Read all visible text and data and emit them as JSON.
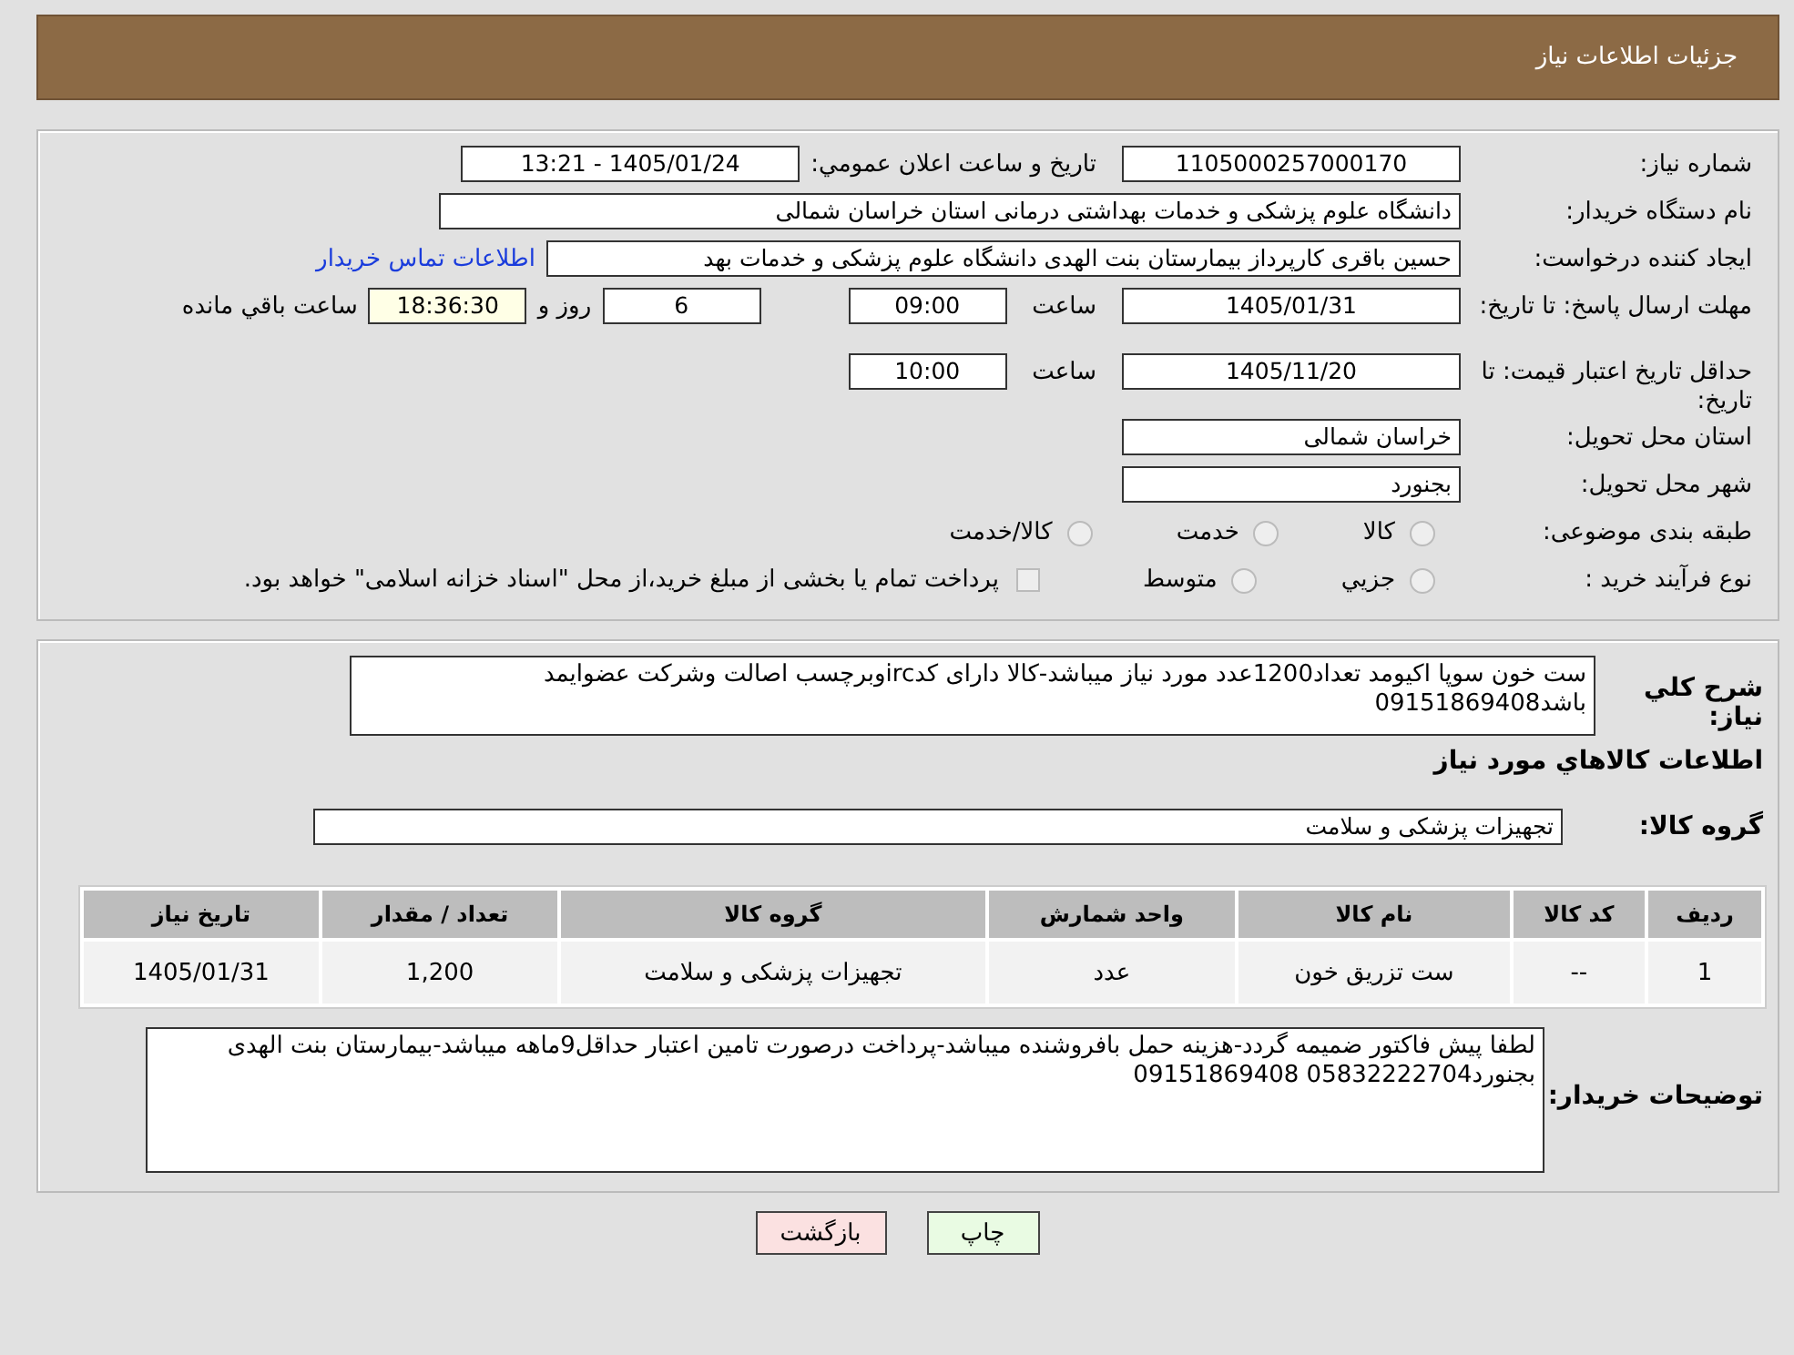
{
  "header": {
    "title": "جزئیات اطلاعات نیاز"
  },
  "details": {
    "need_number": {
      "label": "شماره نیاز:",
      "value": "1105000257000170"
    },
    "announce": {
      "label": "تاریخ و ساعت اعلان عمومي:",
      "value": "1405/01/24 - 13:21"
    },
    "buyer_org": {
      "label": "نام دستگاه خریدار:",
      "value": "دانشگاه علوم پزشکی و خدمات بهداشتی درمانی استان خراسان شمالی"
    },
    "requester": {
      "label": "ایجاد کننده درخواست:",
      "value": "حسین باقری کارپرداز بیمارستان بنت الهدی دانشگاه علوم پزشکی و خدمات بهد",
      "link": "اطلاعات تماس خریدار"
    },
    "reply_deadline": {
      "label": "مهلت ارسال پاسخ: تا تاریخ:",
      "date": "1405/01/31",
      "time_label": "ساعت",
      "time": "09:00",
      "days": "6",
      "days_label": "روز و",
      "remaining": "18:36:30",
      "remaining_label": "ساعت باقي مانده"
    },
    "price_validity": {
      "label": "حداقل تاریخ اعتبار قیمت: تا تاریخ:",
      "date": "1405/11/20",
      "time_label": "ساعت",
      "time": "10:00"
    },
    "province": {
      "label": "استان محل تحویل:",
      "value": "خراسان شمالی"
    },
    "city": {
      "label": "شهر محل تحویل:",
      "value": "بجنورد"
    },
    "category": {
      "label": "طبقه بندی موضوعی:",
      "options": [
        {
          "label": "کالا",
          "selected": false
        },
        {
          "label": "خدمت",
          "selected": false
        },
        {
          "label": "کالا/خدمت",
          "selected": false
        }
      ]
    },
    "purchase_type": {
      "label": "نوع فرآیند خرید :",
      "options": [
        {
          "label": "جزيي",
          "selected": false
        },
        {
          "label": "متوسط",
          "selected": false
        }
      ],
      "treasury": {
        "label": "پرداخت تمام یا بخشی از مبلغ خرید،از محل \"اسناد خزانه اسلامی\" خواهد بود.",
        "checked": false
      }
    }
  },
  "goods": {
    "description": {
      "label": "شرح کلي نیاز:",
      "value": "ست خون سوپا اکیومد تعداد1200عدد مورد نیاز میباشد-کالا دارای کدircوبرچسب اصالت وشرکت عضوایمد باشد09151869408"
    },
    "heading": "اطلاعات کالاهاي مورد نیاز",
    "group": {
      "label": "گروه کالا:",
      "value": "تجهیزات پزشکی و سلامت"
    },
    "table": {
      "columns": [
        "ردیف",
        "کد کالا",
        "نام کالا",
        "واحد شمارش",
        "گروه کالا",
        "تعداد / مقدار",
        "تاریخ نیاز"
      ],
      "rows": [
        [
          "1",
          "--",
          "ست تزریق خون",
          "عدد",
          "تجهیزات پزشکی و سلامت",
          "1,200",
          "1405/01/31"
        ]
      ]
    },
    "buyer_notes": {
      "label": "توضیحات خریدار:",
      "value": "لطفا پیش فاکتور ضمیمه گردد-هزینه حمل بافروشنده میباشد-پرداخت درصورت تامین اعتبار حداقل9ماهه میباشد-بیمارستان بنت الهدی بجنورد05832222704 09151869408"
    }
  },
  "buttons": [
    {
      "kind": "print",
      "label": "چاپ"
    },
    {
      "kind": "back",
      "label": "بازگشت"
    }
  ]
}
